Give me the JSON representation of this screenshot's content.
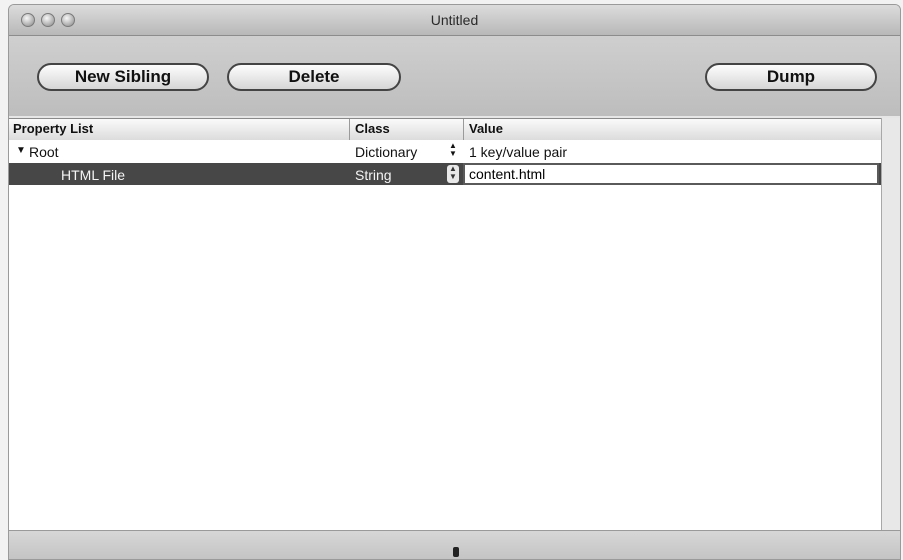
{
  "window": {
    "title": "Untitled"
  },
  "toolbar": {
    "new_sibling_label": "New Sibling",
    "delete_label": "Delete",
    "dump_label": "Dump"
  },
  "table": {
    "columns": [
      "Property List",
      "Class",
      "Value"
    ],
    "rows": [
      {
        "name": "Root",
        "class": "Dictionary",
        "value": "1 key/value pair"
      },
      {
        "name": "HTML File",
        "class": "String",
        "value": "content.html"
      }
    ]
  },
  "icons": {
    "disclosure": "disclosure-triangle-down",
    "stepper": "up-down-arrows"
  }
}
